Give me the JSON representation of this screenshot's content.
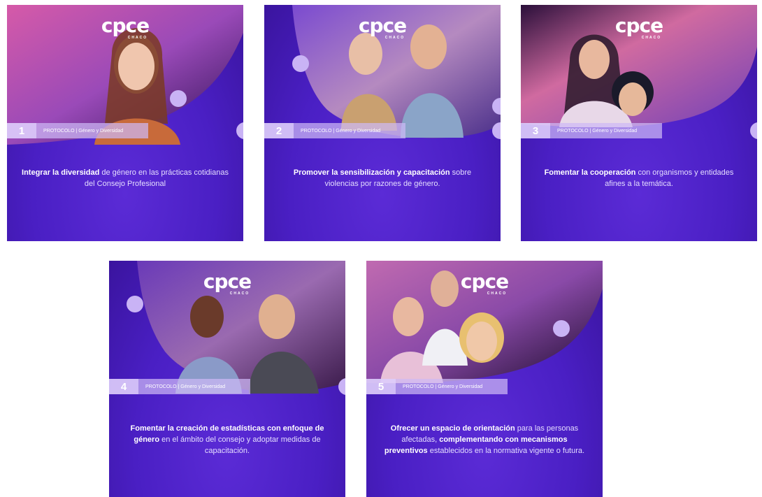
{
  "brand": {
    "mark": "cpce",
    "sub": "CHACO"
  },
  "tag_label": "PROTOCOLO | Género y Diversidad",
  "colors": {
    "background": "#4a1fc4",
    "accent": "#c9b3f5",
    "band": "#cdb9f5"
  },
  "cards": [
    {
      "number": "1",
      "caption": [
        {
          "text": "Integrar la diversidad",
          "bold": true
        },
        {
          "text": " de género en las prácticas cotidianas del Consejo Profesional",
          "bold": false
        }
      ]
    },
    {
      "number": "2",
      "caption": [
        {
          "text": "Promover la sensibilización y capacitación",
          "bold": true
        },
        {
          "text": " sobre violencias por razones de género.",
          "bold": false
        }
      ]
    },
    {
      "number": "3",
      "caption": [
        {
          "text": "Fomentar la cooperación",
          "bold": true
        },
        {
          "text": " con organismos y entidades afines a la temática.",
          "bold": false
        }
      ]
    },
    {
      "number": "4",
      "caption": [
        {
          "text": "Fomentar la creación de estadísticas con enfoque de género",
          "bold": true
        },
        {
          "text": " en el ámbito del consejo y adoptar medidas de capacitación.",
          "bold": false
        }
      ]
    },
    {
      "number": "5",
      "caption": [
        {
          "text": "Ofrecer un espacio de orientación",
          "bold": true
        },
        {
          "text": " para las personas afectadas, ",
          "bold": false
        },
        {
          "text": "complementando con mecanismos preventivos",
          "bold": true
        },
        {
          "text": " establecidos en la normativa vigente o futura.",
          "bold": false
        }
      ]
    }
  ]
}
